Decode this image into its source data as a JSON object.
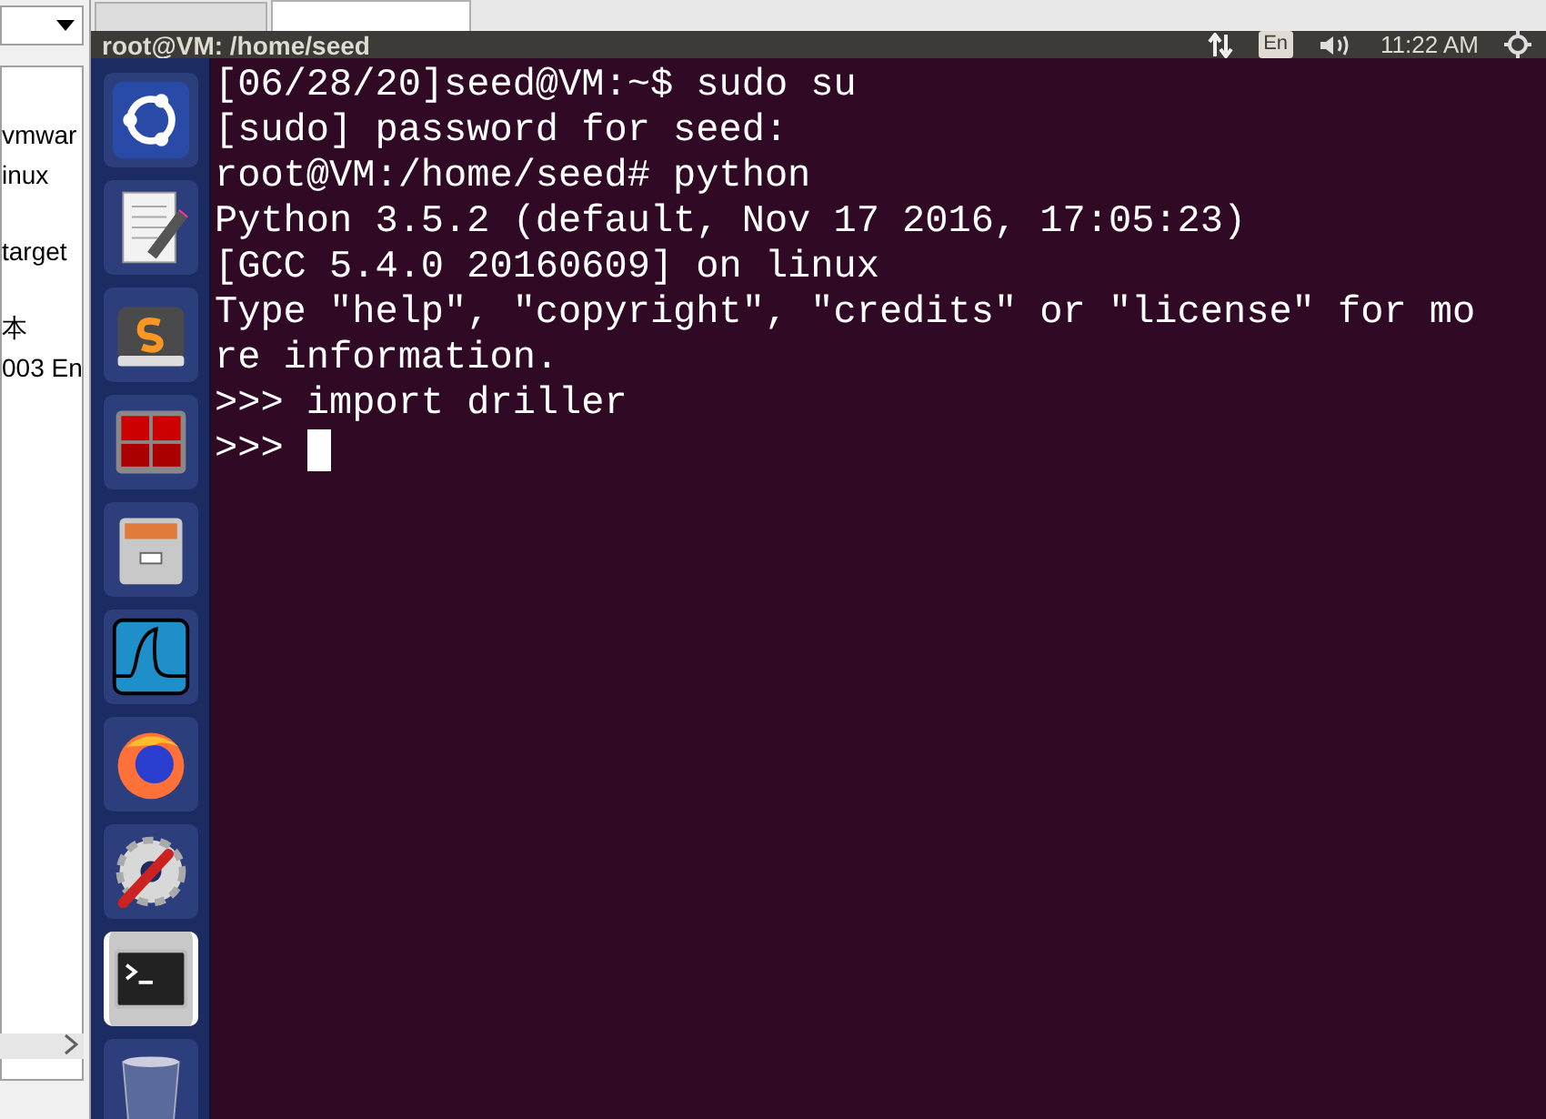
{
  "host_panel": {
    "list_items": [
      {
        "text": "vmwar"
      },
      {
        "text": "inux"
      },
      {
        "text": "target"
      },
      {
        "text": "本"
      },
      {
        "text": "003 En"
      }
    ]
  },
  "window": {
    "title": "root@VM: /home/seed"
  },
  "top_bar": {
    "keyboard_layout": "En",
    "clock": "11:22 AM"
  },
  "launcher": {
    "items": [
      {
        "kind": "ubuntu",
        "selected": false
      },
      {
        "kind": "editor",
        "selected": false
      },
      {
        "kind": "sublime",
        "selected": false
      },
      {
        "kind": "remote",
        "selected": false
      },
      {
        "kind": "files",
        "selected": false
      },
      {
        "kind": "wireshark",
        "selected": false
      },
      {
        "kind": "firefox",
        "selected": false
      },
      {
        "kind": "settings",
        "selected": false
      },
      {
        "kind": "terminal",
        "selected": true
      },
      {
        "kind": "trash",
        "selected": false
      }
    ]
  },
  "terminal": {
    "lines": [
      "[06/28/20]seed@VM:~$ sudo su",
      "[sudo] password for seed:",
      "root@VM:/home/seed# python",
      "Python 3.5.2 (default, Nov 17 2016, 17:05:23)",
      "[GCC 5.4.0 20160609] on linux",
      "Type \"help\", \"copyright\", \"credits\" or \"license\" for mo",
      "re information.",
      ">>> import driller"
    ],
    "prompt": ">>>"
  }
}
